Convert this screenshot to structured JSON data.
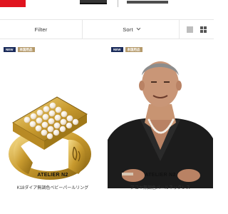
{
  "header": {
    "accent_color": "#e0141e"
  },
  "toolbar": {
    "filter_label": "Filter",
    "sort_label": "Sort"
  },
  "products": [
    {
      "badge_new": "NEW",
      "badge_tag": "本国用品",
      "brand": "ATELIER N2",
      "name": "K18ダイア無調色ベビーパールリング",
      "image": "gold-pearl-ring"
    },
    {
      "badge_new": "NEW",
      "badge_tag": "本国用品",
      "brand": "ATELIER N2",
      "name": "アコヤ無調色パールネックレス",
      "image": "man-wearing-pearl-necklace"
    }
  ]
}
